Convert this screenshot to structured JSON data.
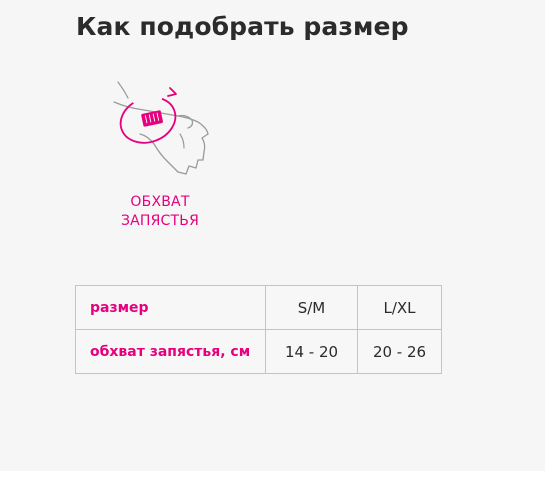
{
  "page": {
    "title": "Как подобрать размер"
  },
  "illustration": {
    "icon": "wrist-measure-icon",
    "caption_lines": [
      "ОБХВАТ",
      "ЗАПЯСТЬЯ"
    ]
  },
  "size_table": {
    "rows": [
      {
        "label": "размер",
        "values": [
          "S/M",
          "L/XL"
        ]
      },
      {
        "label": "обхват запястья, см",
        "values": [
          "14 - 20",
          "20 - 26"
        ]
      }
    ]
  },
  "colors": {
    "accent": "#e6007e",
    "text": "#2b2b2b",
    "background": "#f6f6f6",
    "border": "#c4c4c4"
  }
}
